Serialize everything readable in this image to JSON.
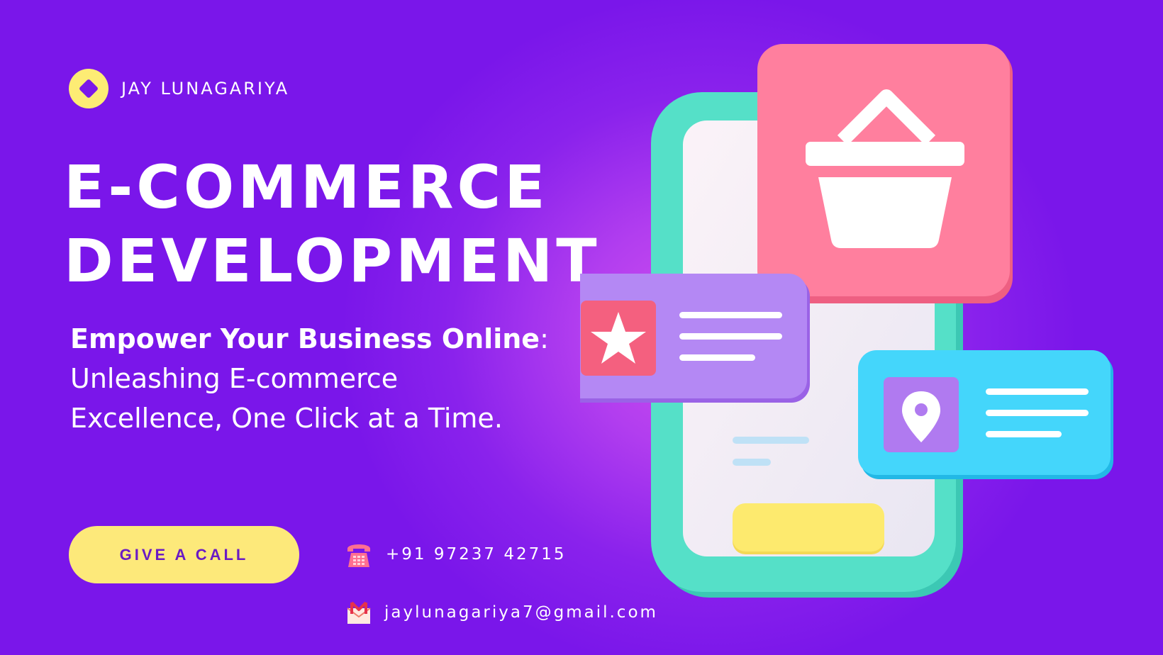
{
  "brand": {
    "name": "JAY LUNAGARIYA",
    "icon": "diamond-logo-icon",
    "color_mark": "#fdec74"
  },
  "headline": {
    "line1": "E-COMMERCE",
    "line2": "DEVELOPMENT"
  },
  "tagline": {
    "bold": "Empower Your Business Online",
    "colon": ":",
    "line2": "Unleashing E-commerce",
    "line3": "Excellence, One Click at a Time."
  },
  "cta": {
    "label": "GIVE A CALL"
  },
  "contact": {
    "phone": "+91 97237 42715",
    "phone_icon": "telephone-icon",
    "email": "jaylunagariya7@gmail.com",
    "email_icon": "gmail-envelope-icon"
  },
  "illustration": {
    "icons": [
      "phone-device-icon",
      "shopping-basket-icon",
      "star-icon",
      "location-pin-icon"
    ]
  },
  "colors": {
    "background": "#7a16ea",
    "background_glow": "#d24ff0",
    "phone_frame": "#4fdcc4",
    "basket_card": "#fe7f9c",
    "star_card": "#b07af0",
    "location_card": "#40d2f8",
    "button": "#fde97a",
    "button_text": "#6a1bc4"
  }
}
